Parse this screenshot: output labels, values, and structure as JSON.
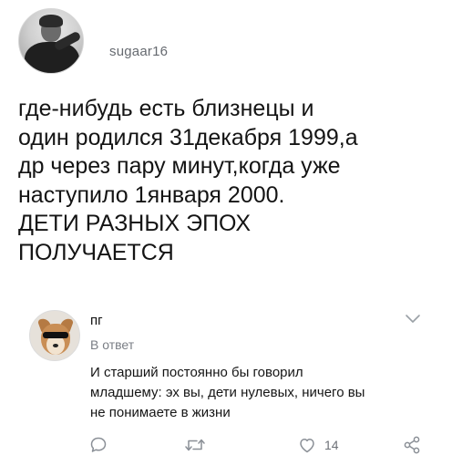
{
  "post": {
    "username": "sugaar16",
    "text": "где-нибудь есть близнецы и\nодин родился 31декабря 1999,а\nдр через пару минут,когда уже\nнаступило 1января 2000.\nДЕТИ РАЗНЫХ ЭПОХ\nПОЛУЧАЕТСЯ"
  },
  "comment": {
    "author": "пг",
    "reply_label": "В ответ",
    "text": "И старший постоянно бы говорил\nмладшему: эх вы, дети нулевых, ничего вы\nне понимаете в жизни"
  },
  "actions": {
    "like_count": "14",
    "icons": [
      "comment-icon",
      "retweet-icon",
      "heart-icon",
      "share-icon",
      "chevron-down-icon"
    ]
  },
  "colors": {
    "text": "#141414",
    "muted": "#6e7278",
    "icon": "#8a8f96"
  }
}
